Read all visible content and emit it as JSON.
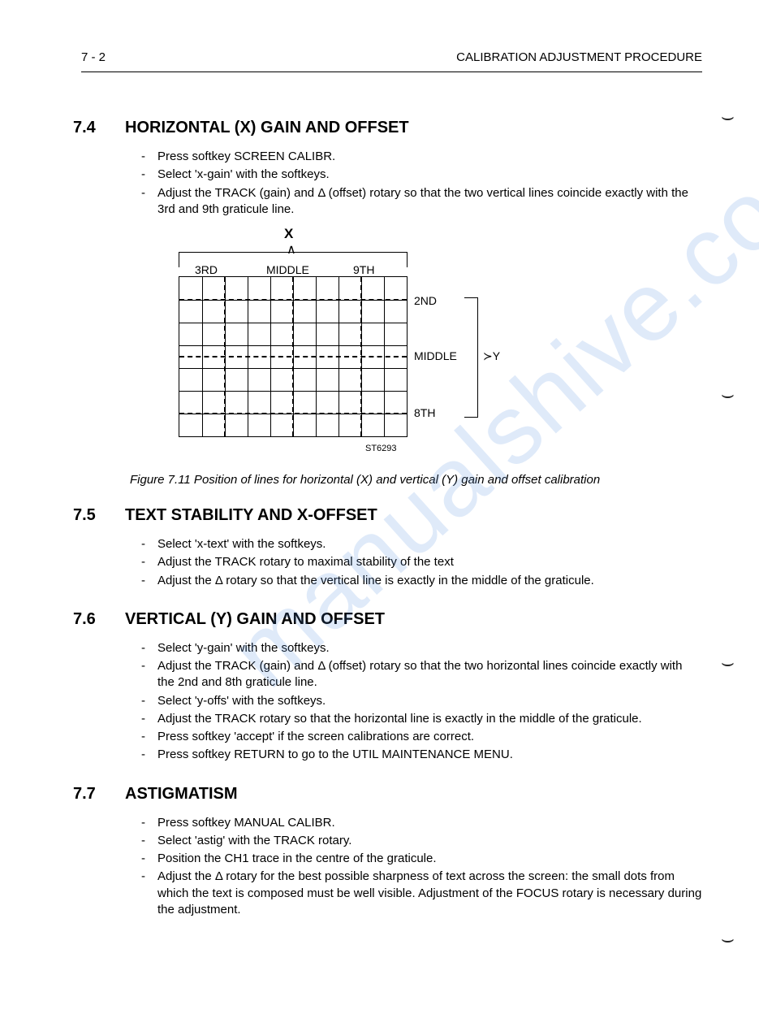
{
  "page_number": "7 - 2",
  "header": "CALIBRATION ADJUSTMENT PROCEDURE",
  "watermark": "manualshive.com",
  "sections": [
    {
      "num": "7.4",
      "title": "HORIZONTAL (X) GAIN AND OFFSET",
      "items": [
        "Press softkey SCREEN CALIBR.",
        "Select 'x-gain' with the softkeys.",
        "Adjust the TRACK (gain) and Δ (offset) rotary so that the two vertical lines coincide exactly with the 3rd and 9th graticule line."
      ]
    },
    {
      "num": "7.5",
      "title": "TEXT STABILITY AND X-OFFSET",
      "items": [
        "Select 'x-text' with the softkeys.",
        "Adjust the TRACK rotary to maximal stability of the text",
        "Adjust the  Δ rotary so that the vertical line is exactly in the middle of the graticule."
      ]
    },
    {
      "num": "7.6",
      "title": "VERTICAL (Y) GAIN AND OFFSET",
      "items": [
        "Select 'y-gain' with the softkeys.",
        "Adjust the TRACK (gain) and Δ (offset) rotary so that the two horizontal lines coincide exactly with the 2nd and 8th graticule line.",
        "Select 'y-offs' with the softkeys.",
        "Adjust the TRACK rotary so that the horizontal line is exactly in the middle of the graticule.",
        "Press softkey 'accept' if the screen calibrations are correct.",
        "Press softkey RETURN to go to the UTIL MAINTENANCE MENU."
      ]
    },
    {
      "num": "7.7",
      "title": "ASTIGMATISM",
      "items": [
        "Press softkey MANUAL CALIBR.",
        "Select 'astig' with the TRACK rotary.",
        "Position the CH1 trace in the centre of the graticule.",
        "Adjust the Δ rotary for the best possible sharpness of text across the screen: the small dots from which the text is composed must be well visible. Adjustment of the FOCUS rotary is necessary during the adjustment."
      ]
    }
  ],
  "figure": {
    "x_label": "X",
    "y_label": "Y",
    "top_labels": {
      "left": "3RD",
      "mid": "MIDDLE",
      "right": "9TH"
    },
    "right_labels": {
      "top": "2ND",
      "mid": "MIDDLE",
      "bot": "8TH"
    },
    "code": "ST6293",
    "caption": "Figure 7.11  Position of lines for horizontal (X) and vertical (Y) gain and offset calibration"
  }
}
